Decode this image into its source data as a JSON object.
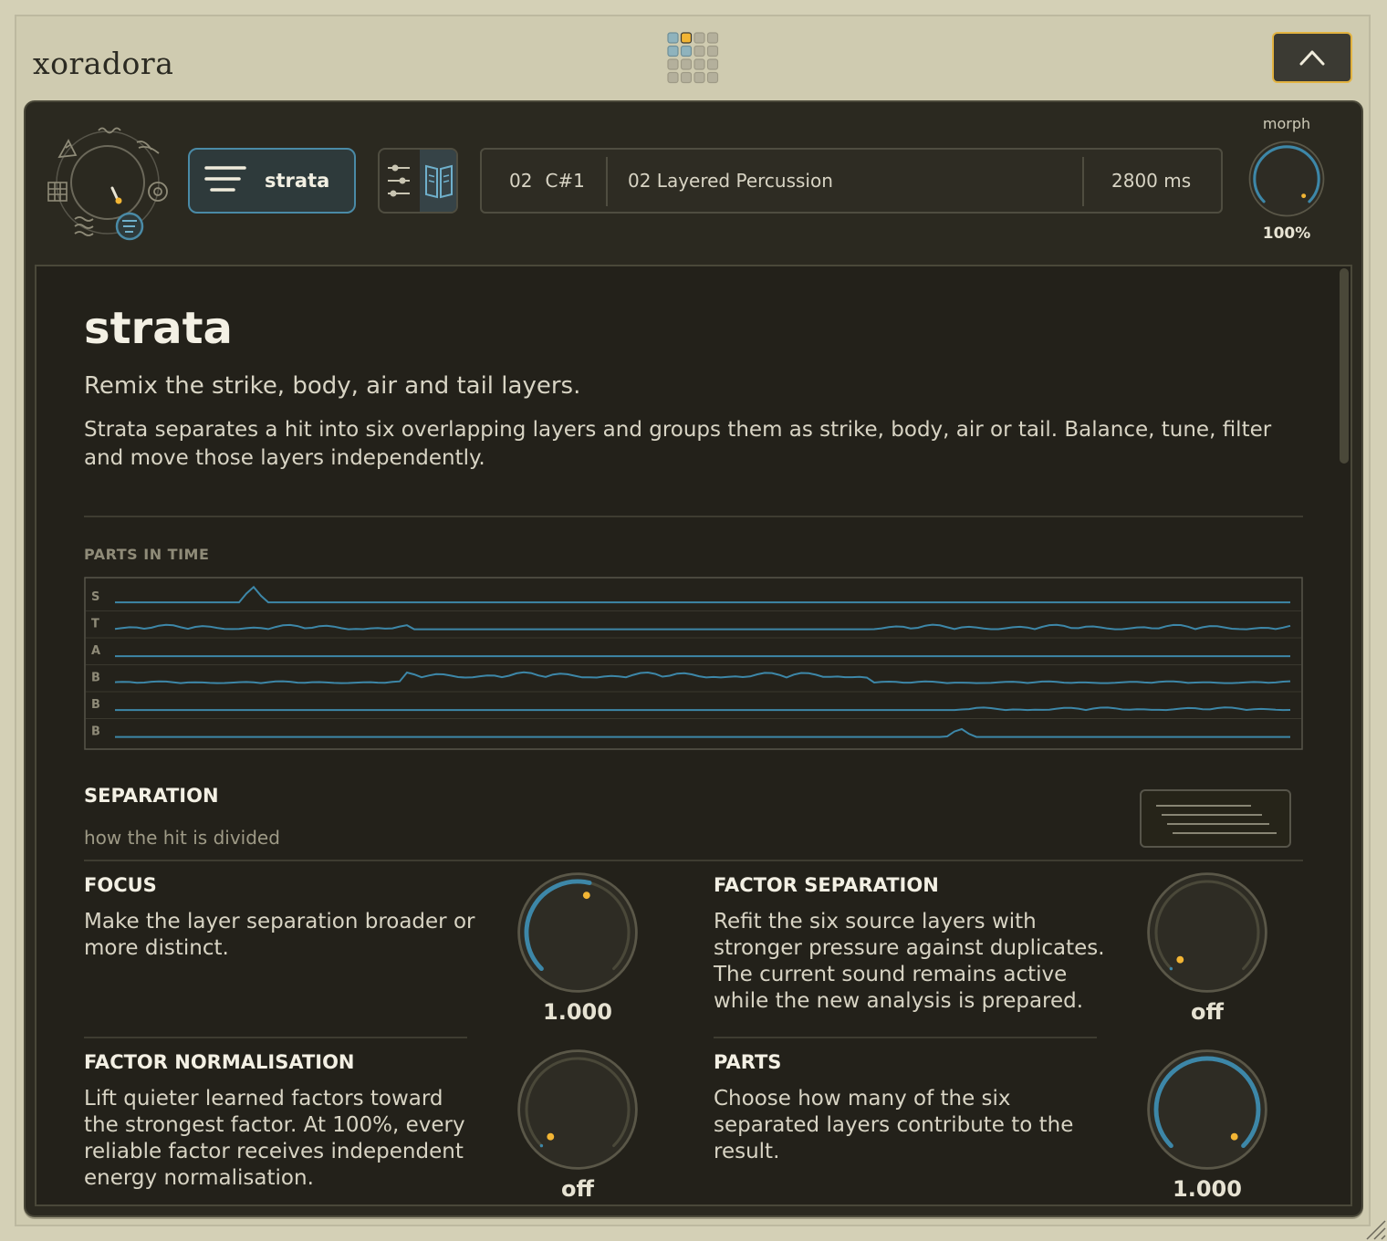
{
  "app": {
    "brand": "xoradora"
  },
  "toolbar": {
    "mode_label": "strata",
    "sample_slot": "02",
    "sample_note": "C#1",
    "sample_name": "02 Layered Percussion",
    "sample_length": "2800 ms",
    "morph_label": "morph",
    "morph_value": "100%",
    "morph_level": 1.0
  },
  "colors": {
    "accent_blue": "#3d87a8",
    "accent_yellow": "#f2b534",
    "panel_bg": "#2b2920",
    "page_bg": "#d4d0b6"
  },
  "page": {
    "title": "strata",
    "subtitle": "Remix the strike, body, air and tail layers.",
    "description": "Strata separates a hit into six overlapping layers and groups them as strike, body, air or tail. Balance, tune, filter and move those layers independently."
  },
  "timeline": {
    "caption": "PARTS IN TIME",
    "rows": [
      {
        "label": "S"
      },
      {
        "label": "T"
      },
      {
        "label": "A"
      },
      {
        "label": "B"
      },
      {
        "label": "B"
      },
      {
        "label": "B"
      }
    ]
  },
  "separation": {
    "title": "SEPARATION",
    "subtitle": "how the hit is divided",
    "params": [
      {
        "title": "FOCUS",
        "description": "Make the layer separation broader or more distinct.",
        "value": "1.000",
        "level": 0.55
      },
      {
        "title": "FACTOR SEPARATION",
        "description": "Refit the six source layers with stronger pressure against duplicates. The current sound remains active while the new analysis is prepared.",
        "value": "off",
        "level": 0.0
      },
      {
        "title": "FACTOR NORMALISATION",
        "description": "Lift quieter learned factors toward the strongest factor. At 100%, every reliable factor receives independent energy normalisation.",
        "value": "off",
        "level": 0.0
      },
      {
        "title": "PARTS",
        "description": "Choose how many of the six separated layers contribute to the result.",
        "value": "1.000",
        "level": 1.0
      }
    ]
  },
  "icons": [
    "grid-icon",
    "chevron-up-icon",
    "mode-dial-icon",
    "strata-lines-icon",
    "sliders-icon",
    "book-icon",
    "separation-lines-icon"
  ]
}
